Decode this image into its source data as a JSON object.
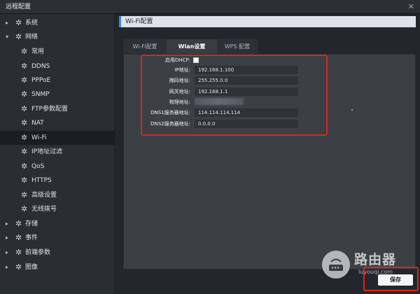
{
  "window": {
    "title": "远程配置",
    "close_glyph": "✕"
  },
  "sidebar": {
    "items": [
      {
        "label": "系统",
        "level": 1,
        "arrow": "▸",
        "icon": "gear-icon"
      },
      {
        "label": "网络",
        "level": 1,
        "arrow": "▾",
        "icon": "gear-icon"
      },
      {
        "label": "常用",
        "level": 2,
        "icon": "gear-icon"
      },
      {
        "label": "DDNS",
        "level": 2,
        "icon": "gear-icon"
      },
      {
        "label": "PPPoE",
        "level": 2,
        "icon": "gear-icon"
      },
      {
        "label": "SNMP",
        "level": 2,
        "icon": "gear-icon"
      },
      {
        "label": "FTP参数配置",
        "level": 2,
        "icon": "gear-icon"
      },
      {
        "label": "NAT",
        "level": 2,
        "icon": "gear-icon"
      },
      {
        "label": "Wi-Fi",
        "level": 2,
        "icon": "gear-icon",
        "active": true
      },
      {
        "label": "IP地址过滤",
        "level": 2,
        "icon": "gear-icon"
      },
      {
        "label": "QoS",
        "level": 2,
        "icon": "gear-icon"
      },
      {
        "label": "HTTPS",
        "level": 2,
        "icon": "gear-icon"
      },
      {
        "label": "高级设置",
        "level": 2,
        "icon": "gear-icon"
      },
      {
        "label": "无线拨号",
        "level": 2,
        "icon": "gear-icon"
      },
      {
        "label": "存储",
        "level": 1,
        "arrow": "▸",
        "icon": "gear-icon"
      },
      {
        "label": "事件",
        "level": 1,
        "arrow": "▸",
        "icon": "gear-icon"
      },
      {
        "label": "前端参数",
        "level": 1,
        "arrow": "▸",
        "icon": "gear-icon"
      },
      {
        "label": "图像",
        "level": 1,
        "arrow": "▸",
        "icon": "gear-icon"
      }
    ]
  },
  "main": {
    "title": "Wi-Fi配置",
    "tabs": [
      {
        "label": "Wi-Fi配置",
        "active": false
      },
      {
        "label": "Wlan设置",
        "active": true
      },
      {
        "label": "WPS 配置",
        "active": false
      }
    ],
    "form": {
      "dhcp_label": "启用DHCP:",
      "dhcp_checked": false,
      "ip_label": "IP地址:",
      "ip_value": "192.168.1.100",
      "mask_label": "掩码地址:",
      "mask_value": "255.255.0.0",
      "gateway_label": "网关地址:",
      "gateway_value": "192.168.1.1",
      "mac_label": "物理地址:",
      "dns1_label": "DNS1服务器地址:",
      "dns1_value": "114.114.114.114",
      "dns2_label": "DNS2服务器地址:",
      "dns2_value": "0.0.0.0"
    },
    "save_label": "保存"
  },
  "watermark": {
    "text": "路由器",
    "url": "luyouqi.com"
  },
  "colors": {
    "highlight": "#e2231a",
    "accent": "#4a89c8"
  }
}
